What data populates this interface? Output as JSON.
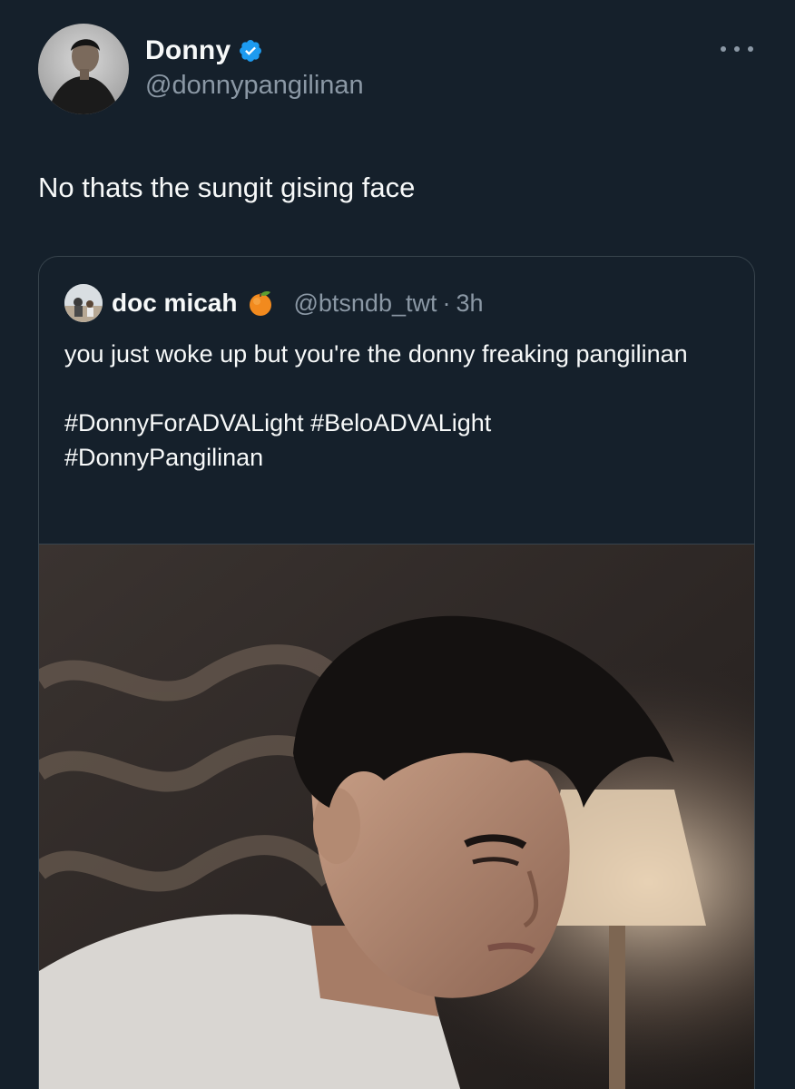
{
  "tweet": {
    "author": {
      "display_name": "Donny",
      "handle": "@donnypangilinan",
      "verified": true
    },
    "text": "No thats the sungit gising face",
    "more_icon": "more-horizontal-icon"
  },
  "quoted_tweet": {
    "author": {
      "display_name": "doc micah",
      "emoji": "🍊",
      "handle": "@btsndb_twt",
      "separator": "·",
      "time": "3h"
    },
    "text_lines": [
      "you just woke up but you're the donny freaking pangilinan",
      "",
      "#DonnyForADVALight #BeloADVALight",
      "#DonnyPangilinan"
    ]
  },
  "colors": {
    "background": "#15202b",
    "text_primary": "#f7f9f9",
    "text_secondary": "#8b98a5",
    "border": "#38444d",
    "verified_badge": "#1d9bf0"
  }
}
